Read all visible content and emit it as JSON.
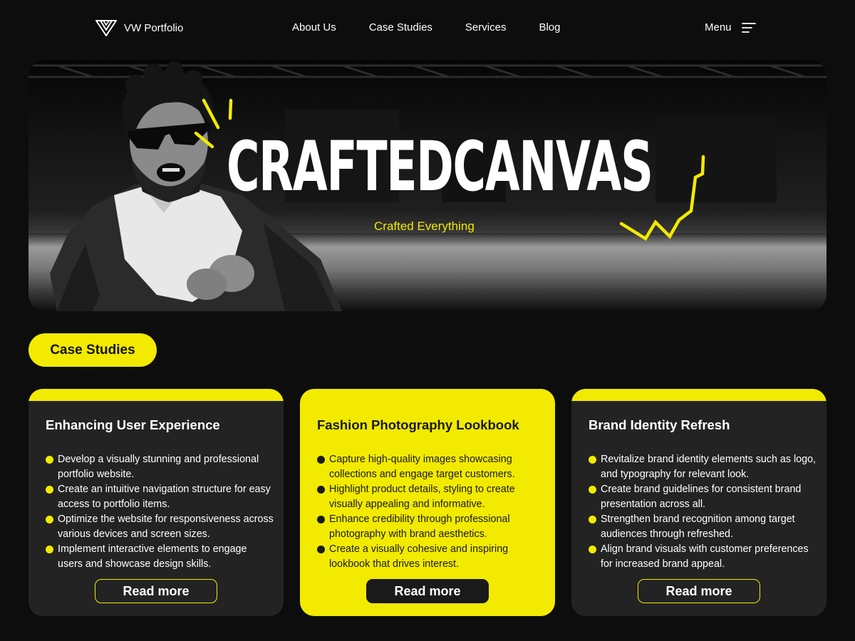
{
  "nav": {
    "logo_text": "VW Portfolio",
    "links": [
      "About Us",
      "Case Studies",
      "Services",
      "Blog"
    ],
    "menu_label": "Menu"
  },
  "hero": {
    "title": "CRAFTEDCANVAS",
    "subtitle": "Crafted Everything"
  },
  "section": {
    "title": "Case Studies"
  },
  "cards": [
    {
      "title": "Enhancing User Experience",
      "items": [
        "Develop a visually stunning and professional portfolio website.",
        "Create an intuitive navigation structure for easy access to portfolio items.",
        "Optimize the website for responsiveness across various devices and screen sizes.",
        "Implement interactive elements to engage users and showcase design skills."
      ],
      "button": "Read more"
    },
    {
      "title": "Fashion Photography Lookbook",
      "items": [
        "Capture high-quality images showcasing collections and engage target customers.",
        "Highlight product details, styling to create visually appealing and informative.",
        "Enhance credibility through professional photography with brand aesthetics.",
        "Create a visually cohesive and inspiring lookbook that drives interest."
      ],
      "button": "Read more"
    },
    {
      "title": "Brand Identity Refresh",
      "items": [
        "Revitalize brand identity elements such as logo, and typography for relevant look.",
        "Create brand guidelines for consistent brand presentation across all.",
        "Strengthen brand recognition among target audiences through refreshed.",
        "Align brand visuals with customer preferences for increased brand appeal."
      ],
      "button": "Read more"
    }
  ],
  "colors": {
    "accent": "#f2ea00",
    "background": "#0d0d0d",
    "card_background": "#232323"
  },
  "icons": {
    "logo": "v-chevron-logo-icon",
    "menu": "hamburger-menu-icon"
  }
}
